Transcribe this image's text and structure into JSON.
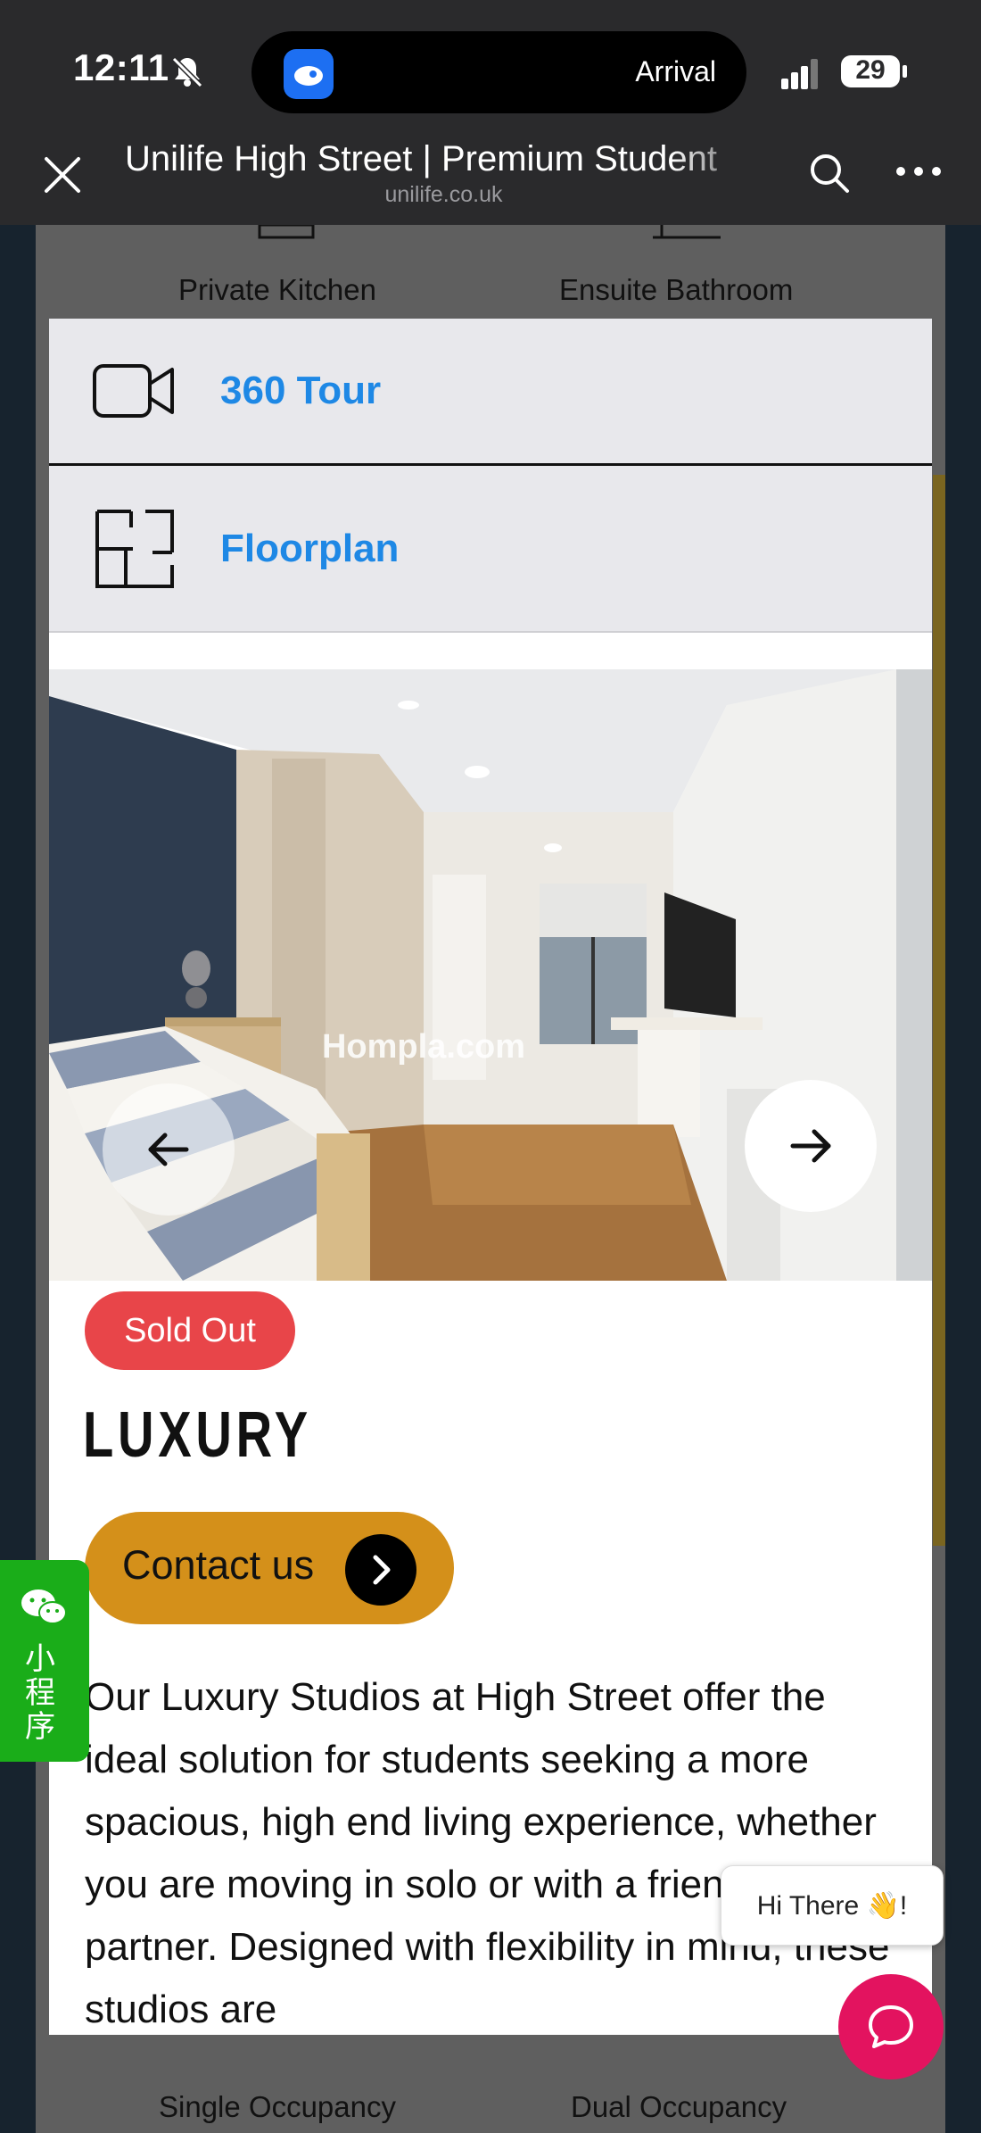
{
  "status_bar": {
    "time": "12:11",
    "dynamic_island_text": "Arrival",
    "battery": "29"
  },
  "browser": {
    "title": "Unilife High Street | Premium Student",
    "url": "unilife.co.uk"
  },
  "background_page": {
    "amenity_top_left": "Private Kitchen",
    "amenity_top_right": "Ensuite Bathroom",
    "occupancy_left": "Single Occupancy",
    "occupancy_right": "Dual Occupancy"
  },
  "modal": {
    "options": [
      {
        "label": "360 Tour",
        "icon": "video-camera-icon"
      },
      {
        "label": "Floorplan",
        "icon": "floorplan-icon"
      }
    ],
    "gallery": {
      "watermark": "Hompla.com"
    },
    "badge": "Sold Out",
    "room_title": "LUXURY",
    "contact_label": "Contact us",
    "description": "Our Luxury Studios at High Street offer the ideal solution for students seeking a more spacious, high end living experience, whether you are moving in solo or with a friend or partner. Designed with flexibility in mind, these studios are"
  },
  "wechat": {
    "label": "小程序"
  },
  "chat": {
    "greeting": "Hi There 👋!"
  },
  "colors": {
    "link_blue": "#1e88e5",
    "sold_red": "#e84549",
    "contact_gold": "#d4901a",
    "wechat_green": "#1aad19",
    "chat_pink": "#e3135f"
  }
}
